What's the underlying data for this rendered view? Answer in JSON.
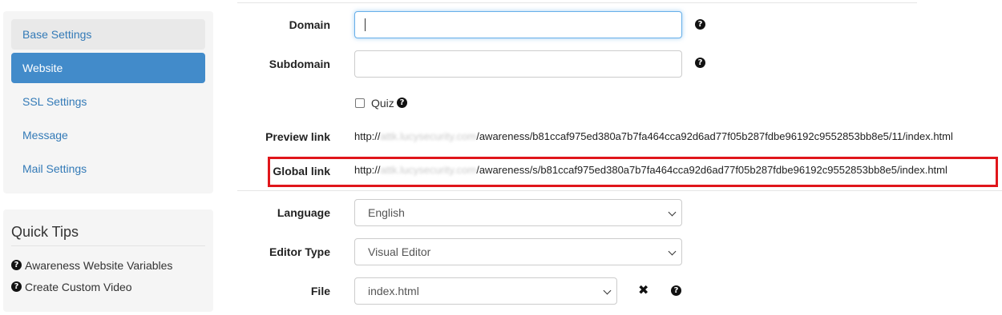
{
  "sidebar": {
    "items": [
      {
        "label": "Base Settings"
      },
      {
        "label": "Website"
      },
      {
        "label": "SSL Settings"
      },
      {
        "label": "Message"
      },
      {
        "label": "Mail Settings"
      }
    ]
  },
  "quick_tips": {
    "title": "Quick Tips",
    "items": [
      {
        "label": "Awareness Website Variables",
        "icon": "question-circle-icon"
      },
      {
        "label": "Create Custom Video",
        "icon": "question-circle-icon"
      }
    ]
  },
  "form": {
    "domain": {
      "label": "Domain",
      "value": ""
    },
    "subdomain": {
      "label": "Subdomain",
      "value": ""
    },
    "quiz": {
      "label": "Quiz",
      "checked": false
    },
    "preview_link": {
      "label": "Preview link",
      "prefix": "http://",
      "host_blurred": "attk.lucysecurity.com",
      "path": "/awareness/b81ccaf975ed380a7b7fa464cca92d6ad77f05b287fdbe96192c9552853bb8e5/11/index.html"
    },
    "global_link": {
      "label": "Global link",
      "prefix": "http://",
      "host_blurred": "attk.lucysecurity.com",
      "path": "/awareness/s/b81ccaf975ed380a7b7fa464cca92d6ad77f05b287fdbe96192c9552853bb8e5/index.html"
    },
    "language": {
      "label": "Language",
      "value": "English"
    },
    "editor_type": {
      "label": "Editor Type",
      "value": "Visual Editor"
    },
    "file": {
      "label": "File",
      "value": "index.html"
    }
  },
  "help_icon_glyph": "?",
  "remove_glyph": "✖",
  "colors": {
    "active_blue": "#428bca",
    "link_blue": "#337ab7",
    "highlight_red": "#e0161b",
    "focus_border": "#66afe9"
  }
}
